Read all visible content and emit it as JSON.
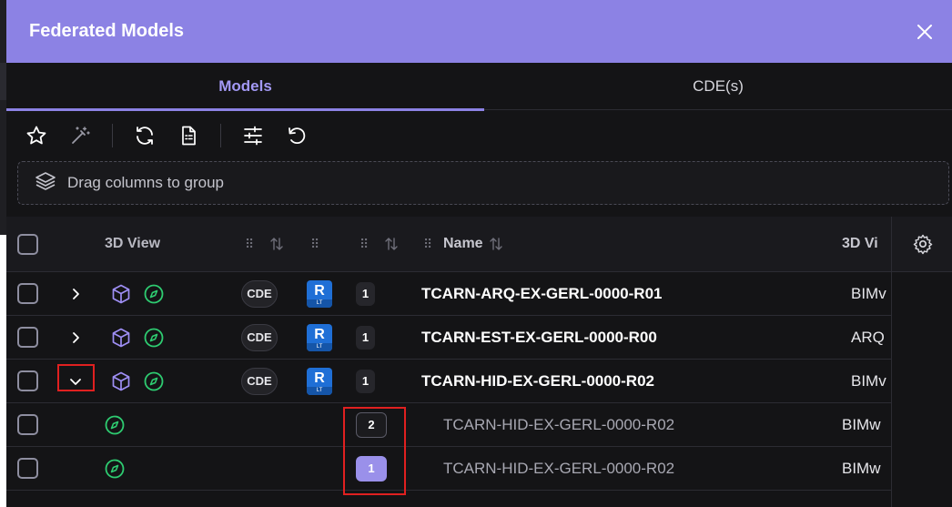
{
  "dialog": {
    "title": "Federated Models",
    "close_icon": "close-icon"
  },
  "tabs": [
    {
      "label": "Models",
      "active": true
    },
    {
      "label": "CDE(s)",
      "active": false
    }
  ],
  "toolbar": {
    "buttons": [
      "star-icon",
      "magic-wand-icon",
      "refresh-icon",
      "document-icon",
      "sliders-icon",
      "undo-icon"
    ]
  },
  "groupbar": {
    "text": "Drag columns to group"
  },
  "columns": {
    "view3d": "3D View",
    "name": "Name",
    "view3d_trunc": "3D Vi"
  },
  "rows": [
    {
      "name": "TCARN-ARQ-EX-GERL-0000-R01",
      "cde": "CDE",
      "app": "R",
      "app_sub": "LT",
      "version": "1",
      "view": "BIMv",
      "expanded": false
    },
    {
      "name": "TCARN-EST-EX-GERL-0000-R00",
      "cde": "CDE",
      "app": "R",
      "app_sub": "LT",
      "version": "1",
      "view": "ARQ",
      "expanded": false
    },
    {
      "name": "TCARN-HID-EX-GERL-0000-R02",
      "cde": "CDE",
      "app": "R",
      "app_sub": "LT",
      "version": "1",
      "view": "BIMv",
      "expanded": true
    }
  ],
  "child_rows": [
    {
      "name": "TCARN-HID-EX-GERL-0000-R02",
      "version": "2",
      "view": "BIMw",
      "selected": false
    },
    {
      "name": "TCARN-HID-EX-GERL-0000-R02",
      "version": "1",
      "view": "BIMw",
      "selected": true
    }
  ],
  "colors": {
    "accent": "#8c82e4",
    "cube_icon": "#9f8ff5",
    "compass_icon": "#2ecc71",
    "highlight": "#e02020"
  }
}
